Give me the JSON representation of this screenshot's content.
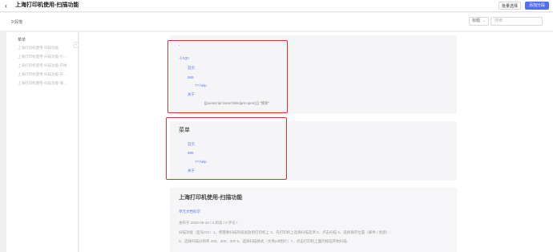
{
  "header": {
    "back_icon": "chevron-left-icon",
    "title": "上海打印机使用-扫描功能",
    "batch_select_label": "批量选择",
    "add_button_label": "添加分段",
    "accent_color": "#4f6ef7"
  },
  "toolbar": {
    "count_label": "9 段落",
    "filter_value": "标题",
    "filter_chevron": "⌄",
    "search_placeholder": "搜索"
  },
  "sidebar": {
    "heading": "菜单",
    "items": [
      "上海打印机使用-扫描功能",
      "上海打印机使用-扫描功能-引...",
      "上海打印机使用-扫描功能-开始",
      "上海打印机使用-扫描功能-开...",
      "上海打印机使用-扫描功能-保..."
    ],
    "collapse_icon": "‹"
  },
  "cards": {
    "code": {
      "dot": "·",
      "logo_alt": "Logo",
      "links": [
        "首页",
        "999",
        "?? help",
        "关于"
      ],
      "js_line": "[[javascript:SearchWidget.open()]]  \"搜索\""
    },
    "menu": {
      "title": "菜单",
      "links": [
        "首页",
        "999",
        "?? help",
        "关于"
      ]
    },
    "article": {
      "title": "上海打印机使用-扫描功能",
      "link": "单元文档标识",
      "meta": "发布于 2025-08-16 / 3 阅读 / 0 评论 /",
      "body_1": "扫描功能（型号OG）1、把需要扫描的纸张放到打印机上 2、先打印机上选择扫描选项 3、点击扫描 4、选择保存位置（邮件 / 优盘）",
      "body_2": "5、选择扫描分辨率 200、400、300 6、选择扫描格式（文件pdf图片）7、点击打印机上面的按钮开始扫描"
    }
  },
  "highlight_color": "#e03030"
}
